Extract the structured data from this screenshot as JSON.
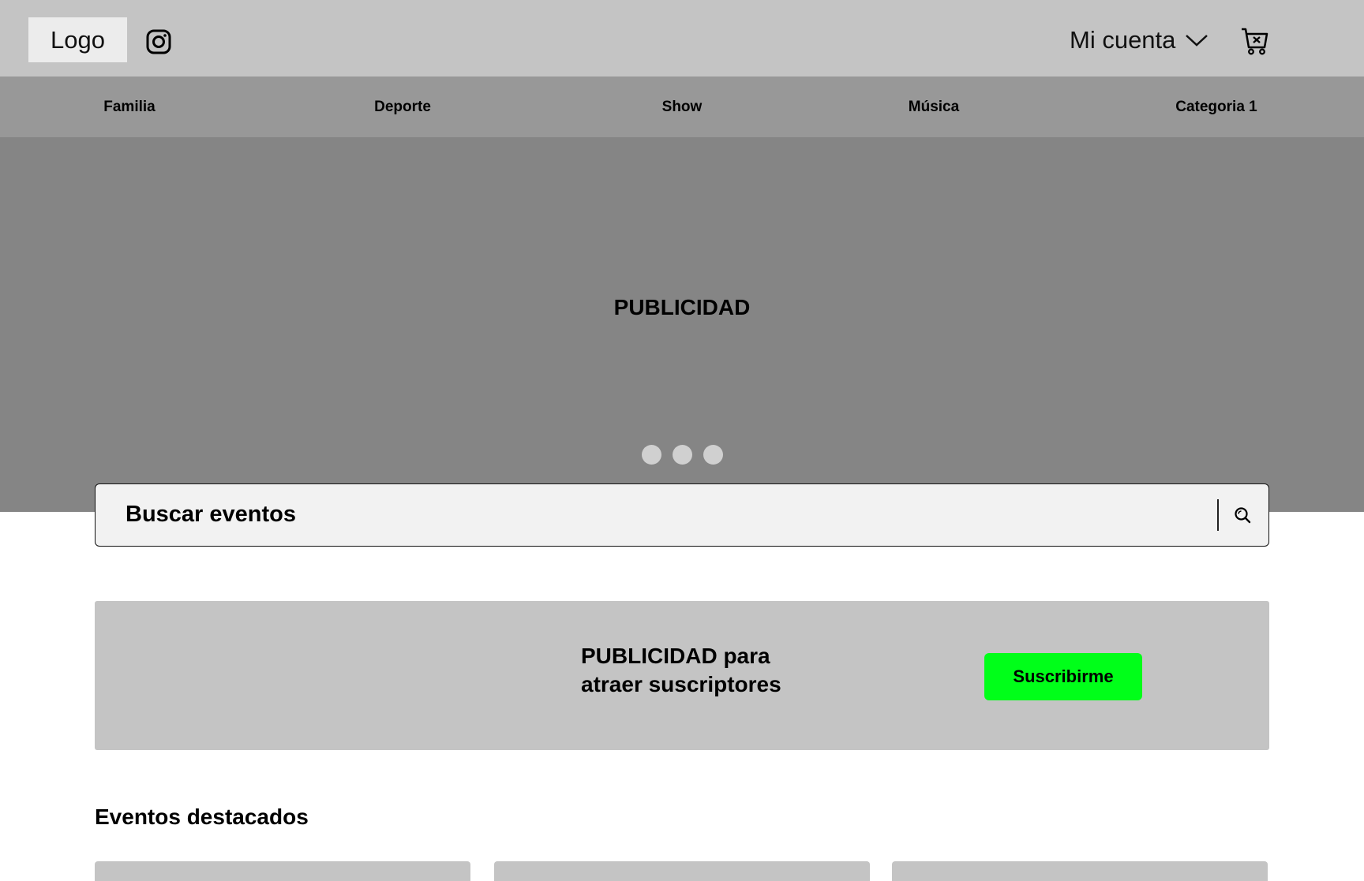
{
  "header": {
    "logo_label": "Logo",
    "social_icon": "instagram-icon",
    "account_label": "Mi cuenta",
    "account_icon": "chevron-down-icon",
    "cart_icon": "cart-icon"
  },
  "nav": {
    "categories": [
      {
        "label": "Familia"
      },
      {
        "label": "Deporte"
      },
      {
        "label": "Show"
      },
      {
        "label": "Música"
      },
      {
        "label": "Categoria 1"
      }
    ]
  },
  "hero": {
    "title": "PUBLICIDAD",
    "slides": 3
  },
  "search": {
    "placeholder": "Buscar eventos",
    "icon": "search-icon"
  },
  "promo": {
    "text_line1": "PUBLICIDAD para",
    "text_line2": "atraer suscriptores",
    "button_label": "Suscribirme",
    "button_color": "#00ff19"
  },
  "featured": {
    "title": "Eventos destacados"
  }
}
